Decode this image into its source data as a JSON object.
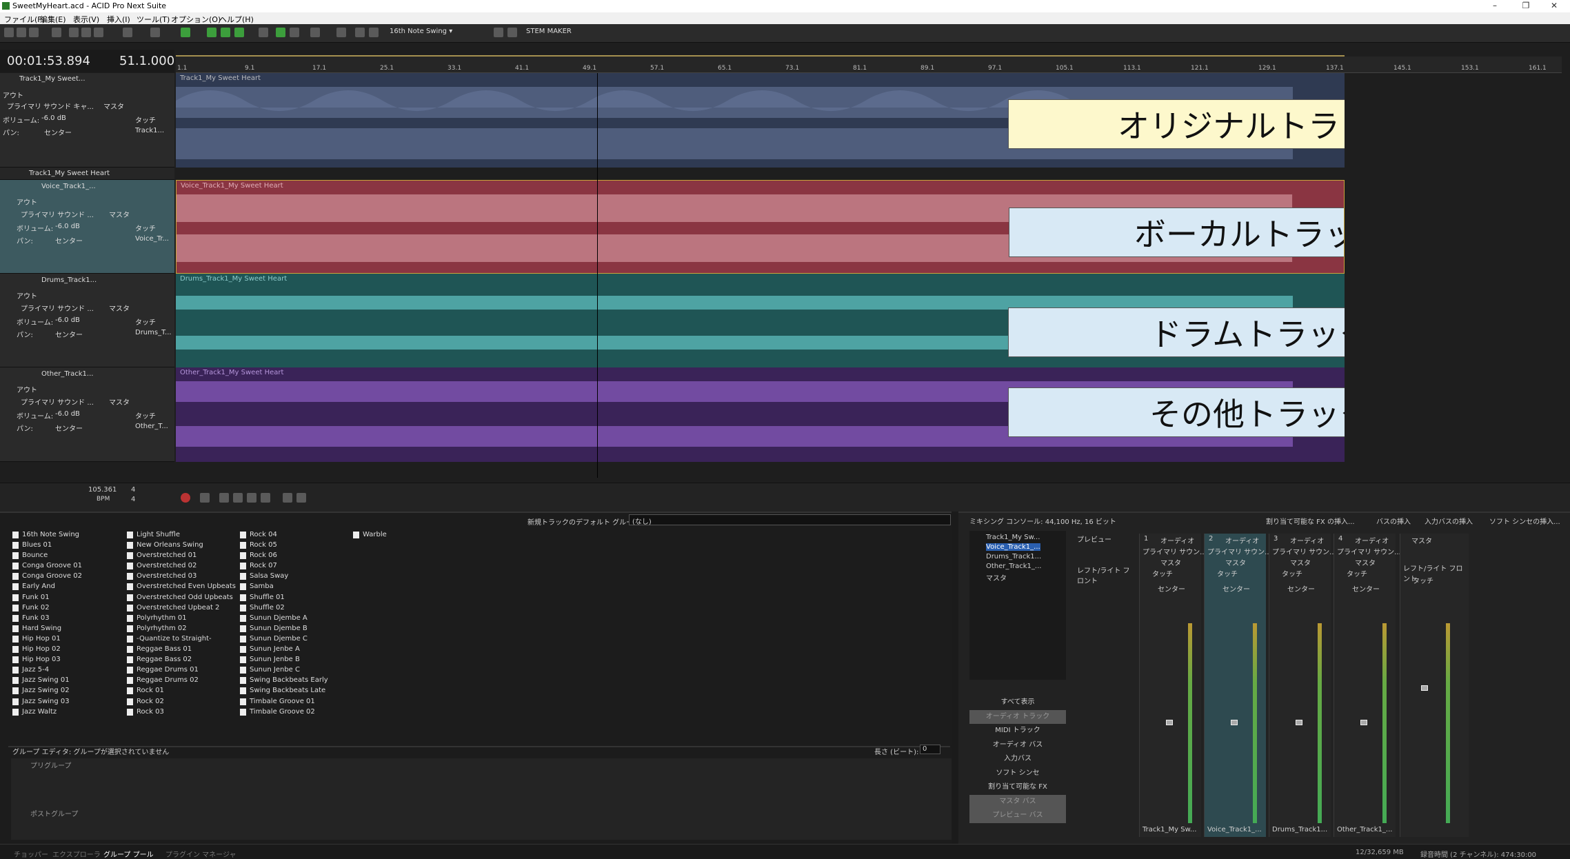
{
  "window": {
    "title": "SweetMyHeart.acd - ACID Pro Next Suite",
    "min": "–",
    "max": "❐",
    "close": "✕"
  },
  "menu": [
    "ファイル(F)",
    "編集(E)",
    "表示(V)",
    "挿入(I)",
    "ツール(T)",
    "オプション(O)",
    "ヘルプ(H)"
  ],
  "toolbar": {
    "swing": "16th Note Swing",
    "stem": "STEM MAKER"
  },
  "time": {
    "timecode": "00:01:53.894",
    "beat": "51.1.000"
  },
  "ruler": [
    "1.1",
    "9.1",
    "17.1",
    "25.1",
    "33.1",
    "41.1",
    "49.1",
    "57.1",
    "65.1",
    "73.1",
    "81.1",
    "89.1",
    "97.1",
    "105.1",
    "113.1",
    "121.1",
    "129.1",
    "137.1",
    "145.1",
    "153.1",
    "161.1"
  ],
  "tracks": [
    {
      "name": "Track1_My Sweet...",
      "clip": "Track1_My Sweet Heart",
      "out": "アウト",
      "bus": "プライマリ サウンド キャ...",
      "master": "マスタ",
      "vol_label": "ボリューム:",
      "vol": "-6.0 dB",
      "touch": "タッチ",
      "pan_label": "パン:",
      "pan": "センター",
      "dest": "Track1...",
      "callout": "オリジナルトラック",
      "color": "#4a5a7a",
      "wave": "#6f7fa3"
    },
    {
      "name": "Voice_Track1_...",
      "clip": "Voice_Track1_My Sweet Heart",
      "out": "アウト",
      "bus": "プライマリ サウンド ...",
      "master": "マスタ",
      "vol_label": "ボリューム:",
      "vol": "-6.0 dB",
      "touch": "タッチ",
      "pan_label": "パン:",
      "pan": "センター",
      "dest": "Voice_Tr...",
      "callout": "ボーカルトラック",
      "color": "#a2404e",
      "wave": "#dca0a8"
    },
    {
      "name": "Drums_Track1...",
      "clip": "Drums_Track1_My Sweet Heart",
      "out": "アウト",
      "bus": "プライマリ サウンド ...",
      "master": "マスタ",
      "vol_label": "ボリューム:",
      "vol": "-6.0 dB",
      "touch": "タッチ",
      "pan_label": "パン:",
      "pan": "センター",
      "dest": "Drums_T...",
      "callout": "ドラムトラック",
      "color": "#215e5e",
      "wave": "#62c4c4"
    },
    {
      "name": "Other_Track1...",
      "clip": "Other_Track1_My Sweet Heart",
      "out": "アウト",
      "bus": "プライマリ サウンド ...",
      "master": "マスタ",
      "vol_label": "ボリューム:",
      "vol": "-6.0 dB",
      "touch": "タッチ",
      "pan_label": "パン:",
      "pan": "センター",
      "dest": "Other_T...",
      "callout": "その他トラック",
      "color": "#3e2460",
      "wave": "#8a5cc0"
    }
  ],
  "folder": {
    "name": "Track1_My Sweet Heart"
  },
  "transport": {
    "bpm": "105.361",
    "bpm_label": "BPM",
    "sig_top": "4",
    "sig_bot": "4"
  },
  "groove": {
    "default_label": "新規トラックのデフォルト グループ:",
    "default_value": "(なし)",
    "col1": [
      "16th Note Swing",
      "Blues 01",
      "Bounce",
      "Conga Groove 01",
      "Conga Groove 02",
      "Early And",
      "Funk 01",
      "Funk 02",
      "Funk 03",
      "Hard Swing",
      "Hip Hop 01",
      "Hip Hop 02",
      "Hip Hop 03",
      "Jazz 5-4",
      "Jazz Swing 01",
      "Jazz Swing 02",
      "Jazz Swing 03",
      "Jazz Waltz"
    ],
    "col2": [
      "Light Shuffle",
      "New Orleans Swing",
      "Overstretched 01",
      "Overstretched 02",
      "Overstretched 03",
      "Overstretched Even Upbeats",
      "Overstretched Odd Upbeats",
      "Overstretched Upbeat 2",
      "Polyrhythm 01",
      "Polyrhythm 02",
      "-Quantize to Straight-",
      "Reggae Bass 01",
      "Reggae Bass 02",
      "Reggae Drums 01",
      "Reggae Drums 02",
      "Rock 01",
      "Rock 02",
      "Rock 03"
    ],
    "col3": [
      "Rock 04",
      "Rock 05",
      "Rock 06",
      "Rock 07",
      "Salsa Sway",
      "Samba",
      "Shuffle 01",
      "Shuffle 02",
      "Sunun Djembe A",
      "Sunun Djembe B",
      "Sunun Djembe C",
      "Sunun Jenbe A",
      "Sunun Jenbe B",
      "Sunun Jenbe C",
      "Swing Backbeats Early",
      "Swing Backbeats Late",
      "Timbale Groove 01",
      "Timbale Groove 02"
    ],
    "col4": [
      "Warble"
    ],
    "editor_label": "グループ エディタ:  グループが選択されていません",
    "len_label": "長さ (ビート):",
    "len_value": "0",
    "pre": "プリグループ",
    "post": "ポストグループ",
    "tabs": [
      "チョッパー",
      "エクスプローラ",
      "グループ プール",
      "プラグイン マネージャ"
    ]
  },
  "mixer": {
    "title": "ミキシング コンソール: 44,100 Hz, 16 ビット",
    "toolbar": [
      "割り当て可能な FX の挿入...",
      "バスの挿入",
      "入力バスの挿入",
      "ソフト シンセの挿入..."
    ],
    "tree": [
      "Track1_My Sw...",
      "Voice_Track1_...",
      "Drums_Track1...",
      "Other_Track1_...",
      "マスタ"
    ],
    "views": [
      "すべて表示",
      "オーディオ トラック",
      "MIDI トラック",
      "オーディオ バス",
      "入力バス",
      "ソフト シンセ",
      "割り当て可能な FX",
      "マスタ バス",
      "プレビュー バス"
    ],
    "preview": "プレビュー",
    "lr": "レフト/ライト フロント",
    "strips": [
      {
        "n": "1",
        "type": "オーディオ",
        "bus": "プライマリ サウン...",
        "out": "マスタ",
        "touch": "タッチ",
        "pan": "センター",
        "name": "Track1_My Sw..."
      },
      {
        "n": "2",
        "type": "オーディオ",
        "bus": "プライマリ サウン...",
        "out": "マスタ",
        "touch": "タッチ",
        "pan": "センター",
        "name": "Voice_Track1_..."
      },
      {
        "n": "3",
        "type": "オーディオ",
        "bus": "プライマリ サウン...",
        "out": "マスタ",
        "touch": "タッチ",
        "pan": "センター",
        "name": "Drums_Track1..."
      },
      {
        "n": "4",
        "type": "オーディオ",
        "bus": "プライマリ サウン...",
        "out": "マスタ",
        "touch": "タッチ",
        "pan": "センター",
        "name": "Other_Track1_..."
      }
    ],
    "master": "マスタ",
    "master_lr": "レフト/ライト フロント",
    "master_touch": "タッチ"
  },
  "status": {
    "mem": "12/32,659 MB",
    "rec": "録音時間 (2 チャンネル): 474:30:00"
  }
}
